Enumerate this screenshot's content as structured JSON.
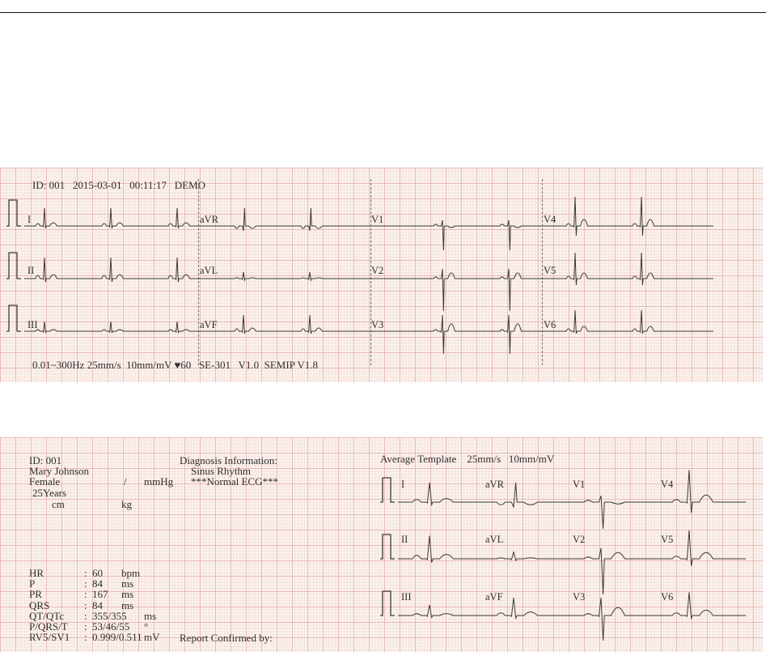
{
  "rhythm_strip": {
    "header": {
      "id": "ID: 001",
      "date": "2015-03-01",
      "time": "00:11:17",
      "mode": "DEMO"
    },
    "leads": [
      "I",
      "aVR",
      "V1",
      "V4",
      "II",
      "aVL",
      "V2",
      "V5",
      "III",
      "aVF",
      "V3",
      "V6"
    ],
    "footer": {
      "filter": "0.01~300Hz",
      "speed": "25mm/s",
      "gain": "10mm/mV",
      "heart_symbol": "♥",
      "hr": "60",
      "device": "SE-301",
      "version": "V1.0",
      "software": "SEMIP V1.8"
    }
  },
  "report": {
    "patient": {
      "id": "ID: 001",
      "name": "Mary Johnson",
      "sex": "Female",
      "bp_separator": "/",
      "bp_unit": "mmHg",
      "age": "25Years",
      "height_unit": "cm",
      "weight_unit": "kg"
    },
    "diagnosis": {
      "title": "Diagnosis Information:",
      "lines": [
        "Sinus Rhythm",
        "***Normal ECG***"
      ]
    },
    "measurements": [
      {
        "label": "HR",
        "value": "60",
        "unit": "bpm"
      },
      {
        "label": "P",
        "value": "84",
        "unit": "ms"
      },
      {
        "label": "PR",
        "value": "167",
        "unit": "ms"
      },
      {
        "label": "QRS",
        "value": "84",
        "unit": "ms"
      },
      {
        "label": "QT/QTc",
        "value": "355/355",
        "unit": "ms"
      },
      {
        "label": "P/QRS/T",
        "value": "53/46/55",
        "unit": "°"
      },
      {
        "label": "RV5/SV1",
        "value": "0.999/0.511",
        "unit": "mV"
      }
    ],
    "confirmed_by": "Report Confirmed by:",
    "template": {
      "title": "Average Template",
      "speed": "25mm/s",
      "gain": "10mm/mV",
      "leads": [
        "I",
        "aVR",
        "V1",
        "V4",
        "II",
        "aVL",
        "V2",
        "V5",
        "III",
        "aVF",
        "V3",
        "V6"
      ]
    }
  },
  "colors": {
    "paper": "#fbf3ee",
    "grid": "#d68282",
    "trace": "#3a3a3a"
  }
}
